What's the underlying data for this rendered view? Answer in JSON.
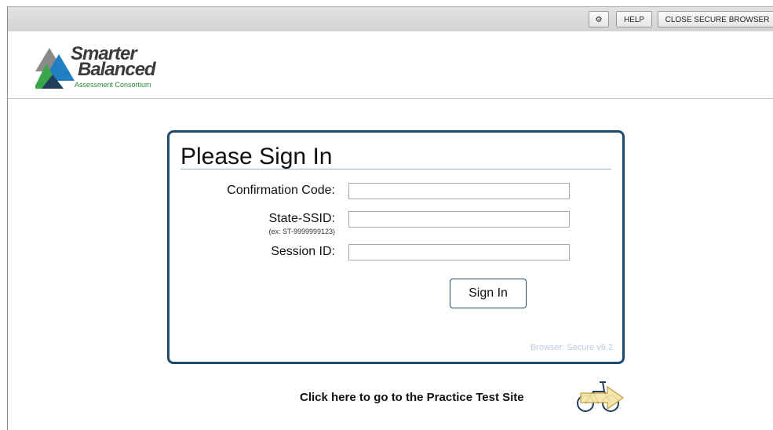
{
  "toolbar": {
    "gear_icon": "⚙",
    "help_label": "HELP",
    "close_label": "CLOSE SECURE BROWSER"
  },
  "logo": {
    "line1": "Smarter",
    "line2": "Balanced",
    "subtitle": "Assessment Consortium",
    "colors": {
      "blue": "#1f7fc1",
      "green": "#3aa54a",
      "dark": "#1f3e5c"
    }
  },
  "signin": {
    "title": "Please Sign In",
    "fields": [
      {
        "label": "Confirmation Code:",
        "value": "",
        "placeholder": ""
      },
      {
        "label": "State-SSID:",
        "hint": "(ex: ST-9999999123)",
        "value": "",
        "placeholder": ""
      },
      {
        "label": "Session ID:",
        "value": "",
        "placeholder": ""
      }
    ],
    "button_label": "Sign In",
    "version": "Browser: Secure v6.2"
  },
  "practice": {
    "link_text": "Click here to go to the Practice Test Site",
    "icon": "bicycle-arrow-icon"
  },
  "colors": {
    "panel_border": "#1e4a6e",
    "toolbar_bg": "#d9d9d9"
  }
}
